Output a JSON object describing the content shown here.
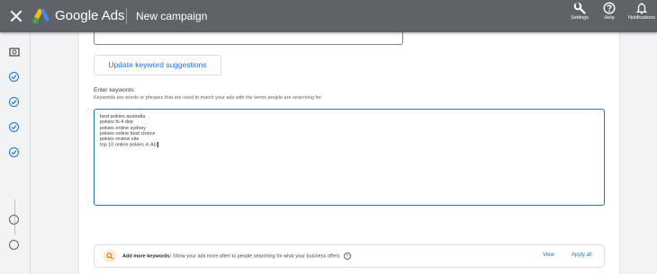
{
  "header": {
    "app_name": "Google Ads",
    "page_title": "New campaign",
    "actions": [
      {
        "label": "Settings",
        "icon": "wrench-icon"
      },
      {
        "label": "Help",
        "icon": "help-icon"
      },
      {
        "label": "Notifications",
        "icon": "bell-icon"
      }
    ]
  },
  "main": {
    "suggest_button_label": "Update keyword suggestions",
    "keywords_label": "Enter keywords",
    "keywords_help": "Keywords are words or phrases that are used to match your ads with the terms people are searching for",
    "keywords": [
      "best pokies australia",
      "pokies fs 4 dep",
      "pokies online sydney",
      "pokies online best choice",
      "pokies review site",
      "top 10 online pokies in AU"
    ],
    "tip": {
      "bold": "Add more keywords:",
      "text": "Show your ads more often to people searching for what your business offers",
      "view_label": "View",
      "apply_label": "Apply all"
    }
  },
  "colors": {
    "header_bg": "#5f6368",
    "accent": "#1a73e8",
    "tip_icon_bg": "#fce8d4",
    "tip_icon": "#e8710a"
  }
}
